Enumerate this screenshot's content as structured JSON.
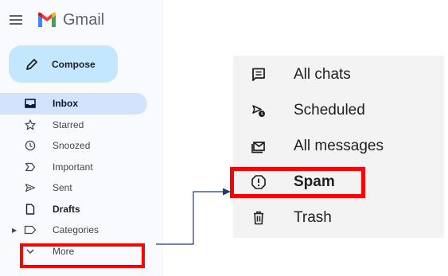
{
  "gmail": {
    "app_name": "Gmail",
    "compose_label": "Compose",
    "nav": [
      {
        "label": "Inbox",
        "icon": "inbox-icon"
      },
      {
        "label": "Starred",
        "icon": "star-icon"
      },
      {
        "label": "Snoozed",
        "icon": "clock-icon"
      },
      {
        "label": "Important",
        "icon": "important-icon"
      },
      {
        "label": "Sent",
        "icon": "send-icon"
      },
      {
        "label": "Drafts",
        "icon": "draft-icon"
      },
      {
        "label": "Categories",
        "icon": "label-icon"
      },
      {
        "label": "More",
        "icon": "chevron-down-icon"
      }
    ]
  },
  "more_menu": {
    "items": [
      {
        "label": "All chats",
        "icon": "chat-icon"
      },
      {
        "label": "Scheduled",
        "icon": "scheduled-send-icon"
      },
      {
        "label": "All messages",
        "icon": "all-mail-icon"
      },
      {
        "label": "Spam",
        "icon": "spam-icon"
      },
      {
        "label": "Trash",
        "icon": "trash-icon"
      }
    ]
  },
  "colors": {
    "highlight": "#ff0000",
    "compose_bg": "#c2e7ff",
    "active_bg": "#d3e3fd",
    "connector": "#1f3b73"
  }
}
